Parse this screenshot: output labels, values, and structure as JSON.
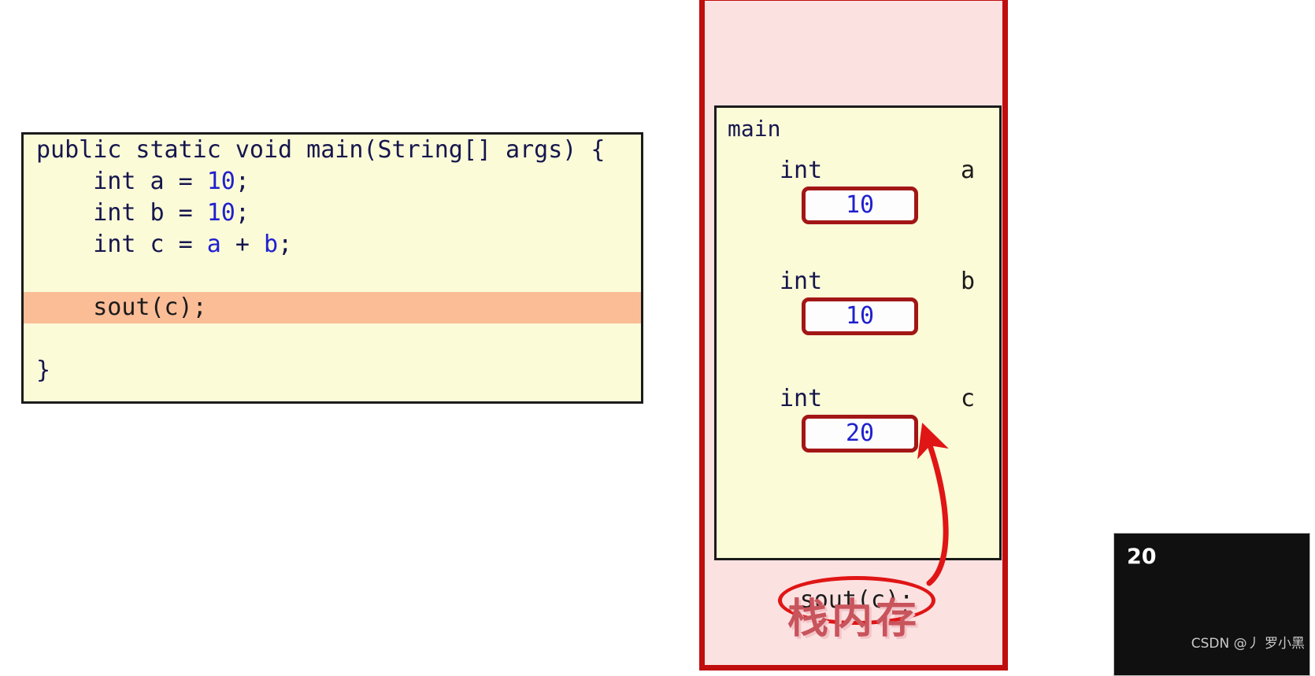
{
  "code_panel": {
    "lines": [
      {
        "id": "l1",
        "segments": [
          {
            "t": "public static void main(String[] args) {",
            "c": "plain"
          }
        ],
        "highlight": false
      },
      {
        "id": "l2",
        "segments": [
          {
            "t": "    int a = ",
            "c": "plain"
          },
          {
            "t": "10",
            "c": "num"
          },
          {
            "t": ";",
            "c": "plain"
          }
        ],
        "highlight": false
      },
      {
        "id": "l3",
        "segments": [
          {
            "t": "    int b = ",
            "c": "plain"
          },
          {
            "t": "10",
            "c": "num"
          },
          {
            "t": ";",
            "c": "plain"
          }
        ],
        "highlight": false
      },
      {
        "id": "l4",
        "segments": [
          {
            "t": "    int c = ",
            "c": "plain"
          },
          {
            "t": "a",
            "c": "var"
          },
          {
            "t": " + ",
            "c": "plain"
          },
          {
            "t": "b",
            "c": "var"
          },
          {
            "t": ";",
            "c": "plain"
          }
        ],
        "highlight": false
      },
      {
        "id": "l5",
        "segments": [
          {
            "t": " ",
            "c": "plain"
          }
        ],
        "highlight": false
      },
      {
        "id": "l6",
        "segments": [
          {
            "t": "    sout(c);",
            "c": "dark"
          }
        ],
        "highlight": true
      },
      {
        "id": "l7",
        "segments": [
          {
            "t": " ",
            "c": "plain"
          }
        ],
        "highlight": false
      },
      {
        "id": "l8",
        "segments": [
          {
            "t": "}",
            "c": "plain"
          }
        ],
        "highlight": false
      }
    ],
    "highlighted_line_text": "    sout(c);"
  },
  "stack_memory": {
    "title": "栈内存",
    "frame_label": "main",
    "variables": [
      {
        "type": "int",
        "name": "a",
        "value": "10"
      },
      {
        "type": "int",
        "name": "b",
        "value": "10"
      },
      {
        "type": "int",
        "name": "c",
        "value": "20"
      }
    ],
    "annotation": {
      "circled_statement": "sout(c);",
      "arrow_from": "sout(c);",
      "arrow_to": "c"
    },
    "colors": {
      "outer_border": "#c00d0d",
      "outer_fill": "#fce1e1",
      "frame_fill": "#fbfbd8",
      "value_box_border": "#a31616",
      "value_text": "#2020cf",
      "annotation_red": "#e01515",
      "title_color": "#c8545c"
    }
  },
  "console": {
    "output": "20",
    "watermark": "CSDN @丿 罗小黑",
    "background": "#101010"
  }
}
